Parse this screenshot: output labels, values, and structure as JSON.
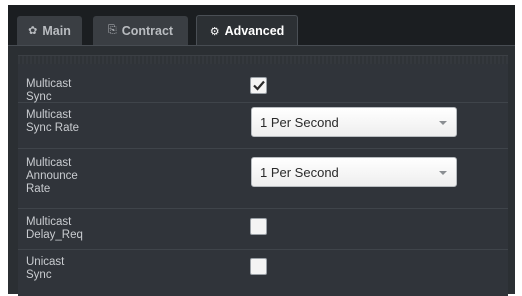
{
  "tabs": [
    {
      "label": "Main",
      "icon": "gear-icon",
      "active": false
    },
    {
      "label": "Contract",
      "icon": "document-icon",
      "active": false
    },
    {
      "label": "Advanced",
      "icon": "gears-icon",
      "active": true
    }
  ],
  "settings": {
    "multicast_sync": {
      "label": "Multicast\nSync",
      "checked": true
    },
    "multicast_sync_rate": {
      "label": "Multicast\nSync Rate",
      "value": "1 Per Second"
    },
    "multicast_announce_rate": {
      "label": "Multicast\nAnnounce\nRate",
      "value": "1 Per Second"
    },
    "multicast_delay_req": {
      "label": "Multicast\nDelay_Req",
      "checked": false
    },
    "unicast_sync": {
      "label": "Unicast\nSync",
      "checked": false
    }
  },
  "colors": {
    "background": "#2b2f33",
    "tab_active_text": "#ffffff",
    "label_text": "#c9ccd0"
  }
}
